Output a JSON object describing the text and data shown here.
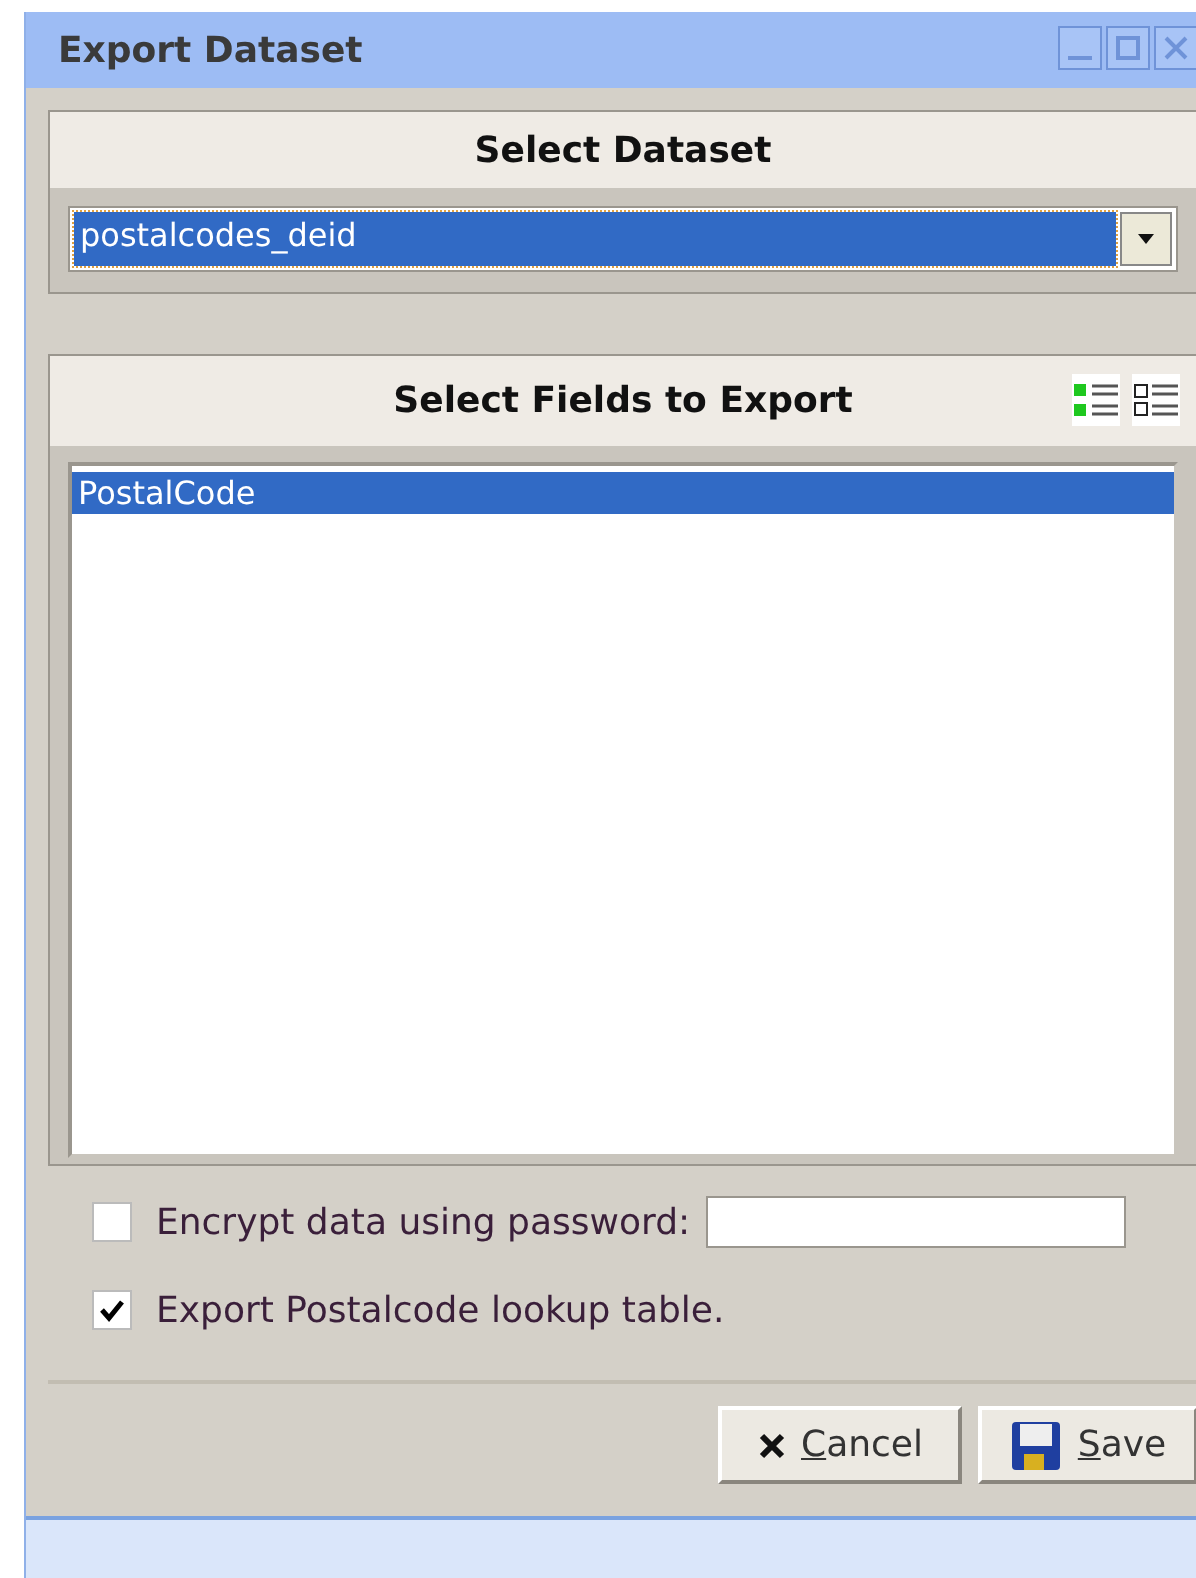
{
  "window": {
    "title": "Export Dataset"
  },
  "dataset_panel": {
    "title": "Select Dataset",
    "selected_value": "postalcodes_deid"
  },
  "fields_panel": {
    "title": "Select Fields to Export",
    "fields": [
      {
        "label": "PostalCode",
        "selected": true
      }
    ]
  },
  "options": [
    {
      "label": "Encrypt data using password:",
      "checked": false,
      "kind": "password"
    },
    {
      "label": "Export Postalcode lookup table.",
      "checked": true,
      "kind": "plain"
    }
  ],
  "buttons": [
    {
      "label": "Cancel",
      "kind": "cancel"
    },
    {
      "label": "Save",
      "kind": "save"
    }
  ]
}
